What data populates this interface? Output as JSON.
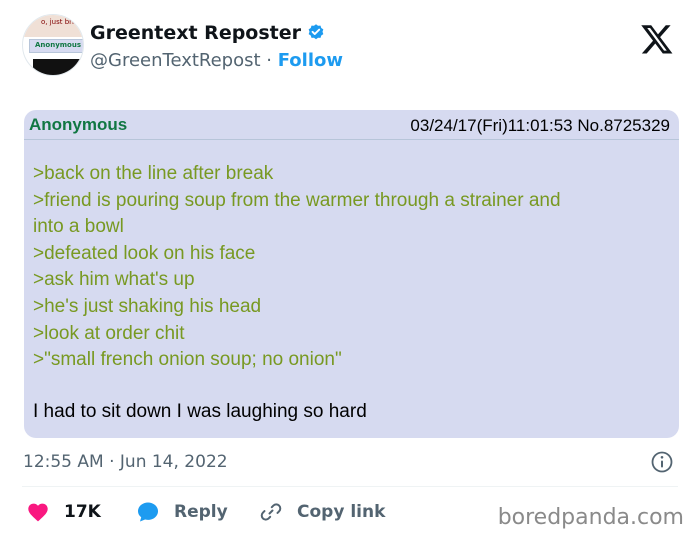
{
  "author": {
    "display_name": "Greentext Reposter",
    "handle": "@GreenTextRepost",
    "separator": " · ",
    "follow_label": "Follow",
    "avatar": {
      "thumb_top_text": "o, just bri",
      "thumb_name_text": "Anonymous"
    }
  },
  "post": {
    "poster_name": "Anonymous",
    "meta": "03/24/17(Fri)11:01:53 No.8725329",
    "greentext_lines": [
      ">back on the line after break",
      ">friend is pouring soup from the warmer through a strainer and",
      "into a bowl",
      ">defeated look on his face",
      ">ask him what's up",
      ">he's just shaking his head",
      ">look at order chit",
      ">\"small french onion soup; no onion\""
    ],
    "plain_text": "I had to sit down I was laughing so hard"
  },
  "tweet": {
    "timestamp": "12:55 AM · Jun 14, 2022"
  },
  "actions": {
    "likes": "17K",
    "reply_label": "Reply",
    "copy_link_label": "Copy link"
  },
  "watermark": "boredpanda.com",
  "colors": {
    "greentext": "#789922",
    "poster_name": "#117743",
    "post_background": "#d6daf0",
    "like_red": "#f91880",
    "reply_blue": "#1d9bf0",
    "verified_blue": "#1d9bf0"
  },
  "icons": [
    "verified-badge-icon",
    "x-logo-icon",
    "info-icon",
    "heart-icon",
    "reply-bubble-icon",
    "link-icon"
  ]
}
